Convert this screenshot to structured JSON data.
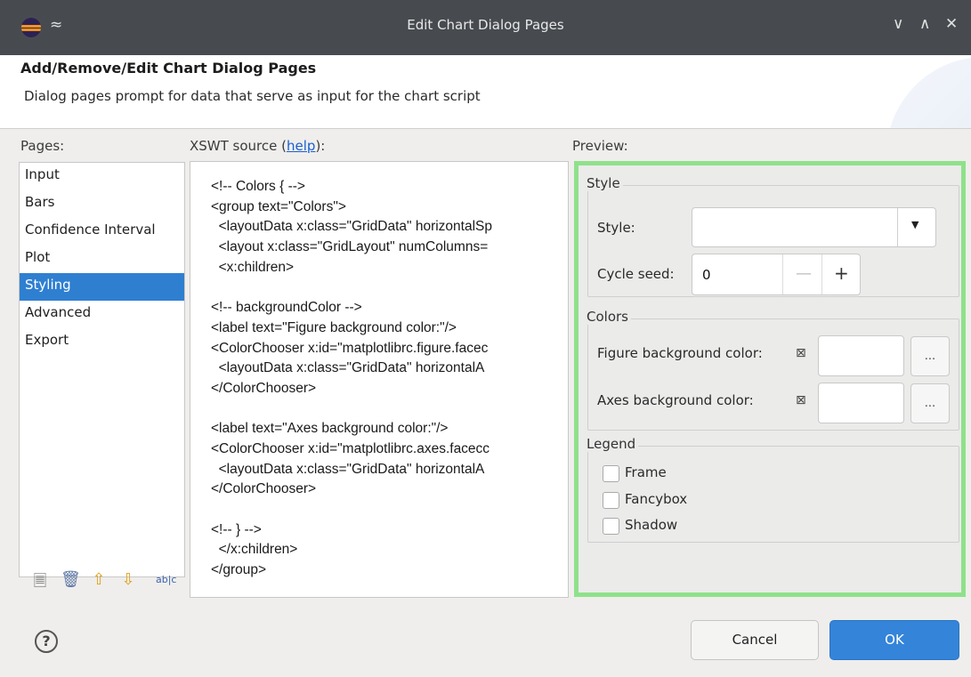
{
  "window": {
    "title": "Edit Chart Dialog Pages",
    "collapse_glyph": "≈",
    "minimize_glyph": "∨",
    "maximize_glyph": "∧",
    "close_glyph": "✕"
  },
  "header": {
    "title": "Add/Remove/Edit Chart Dialog Pages",
    "description": "Dialog pages prompt for data that serve as input for the chart script"
  },
  "pages": {
    "label": "Pages:",
    "items": [
      "Input",
      "Bars",
      "Confidence Interval",
      "Plot",
      "Styling",
      "Advanced",
      "Export"
    ],
    "selected": "Styling",
    "tools": {
      "new_icon": "new-page-icon",
      "delete_icon": "trash-icon",
      "up_icon": "move-up-icon",
      "down_icon": "move-down-icon",
      "rename_icon": "rename-icon",
      "rename_glyph": "ab|c"
    }
  },
  "source": {
    "label_prefix": "XSWT source (",
    "help_link": "help",
    "label_suffix": "):",
    "lines": [
      "<!-- Colors { -->",
      "<group text=\"Colors\">",
      "  <layoutData x:class=\"GridData\" horizontalSp",
      "  <layout x:class=\"GridLayout\" numColumns=",
      "  <x:children>",
      "",
      "<!-- backgroundColor -->",
      "<label text=\"Figure background color:\"/>",
      "<ColorChooser x:id=\"matplotlibrc.figure.facec",
      "  <layoutData x:class=\"GridData\" horizontalA",
      "</ColorChooser>",
      "",
      "<label text=\"Axes background color:\"/>",
      "<ColorChooser x:id=\"matplotlibrc.axes.facecc",
      "  <layoutData x:class=\"GridData\" horizontalA",
      "</ColorChooser>",
      "",
      "<!-- } -->",
      "  </x:children>",
      "</group>"
    ]
  },
  "preview": {
    "label": "Preview:",
    "highlight_color": "#8fe18a",
    "style_group": {
      "title": "Style",
      "style_label": "Style:",
      "style_value": "",
      "cycle_seed_label": "Cycle seed:",
      "cycle_seed_value": "0",
      "minus": "—",
      "plus": "+"
    },
    "colors_group": {
      "title": "Colors",
      "figure_bg_label": "Figure background color:",
      "axes_bg_label": "Axes background color:",
      "browse_label": "...",
      "default_marker": "⊠"
    },
    "legend_group": {
      "title": "Legend",
      "frame_label": "Frame",
      "fancybox_label": "Fancybox",
      "shadow_label": "Shadow",
      "frame_checked": false,
      "fancybox_checked": false,
      "shadow_checked": false
    }
  },
  "footer": {
    "help_glyph": "?",
    "cancel_label": "Cancel",
    "ok_label": "OK"
  },
  "colors": {
    "titlebar": "#474b50",
    "selection": "#2f7fd1",
    "primary_button": "#3484da",
    "link": "#1a5fd0"
  }
}
